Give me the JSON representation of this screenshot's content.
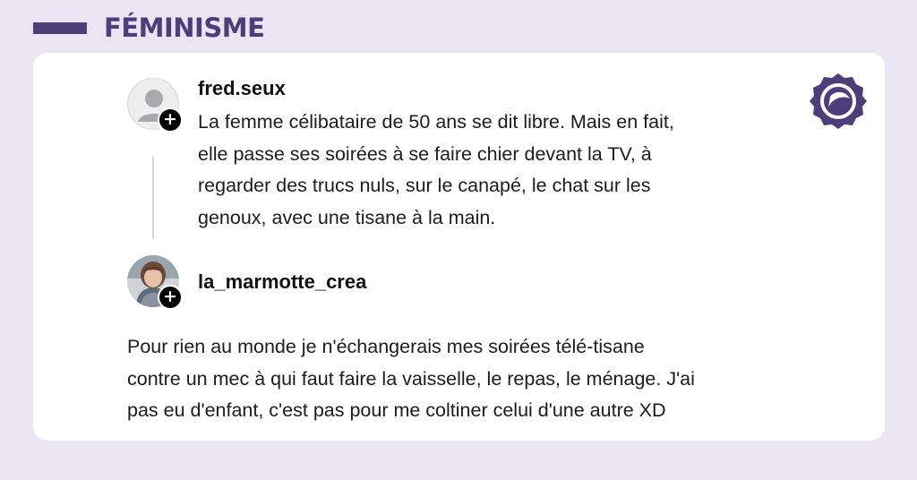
{
  "header": {
    "title": "FÉMINISME"
  },
  "posts": [
    {
      "username": "fred.seux",
      "avatar": "default-user-silhouette",
      "text": "La femme célibataire de 50 ans se dit libre. Mais en fait,\nelle passe ses soirées à se faire chier devant la TV, à\nregarder des trucs nuls, sur le canapé, le chat sur les\ngenoux, avec une tisane à la main."
    },
    {
      "username": "la_marmotte_crea",
      "avatar": "profile-photo",
      "text": "Pour rien au monde je n'échangerais mes soirées télé-tisane\ncontre un mec à qui faut faire la vaisselle, le repas, le ménage. J'ai\npas eu d'enfant, c'est pas pour me coltiner celui d'une autre XD"
    }
  ],
  "badge_symbol": "+",
  "colors": {
    "accent": "#4b3e79",
    "background": "#e9e5f3",
    "card": "#ffffff",
    "text": "#1c1c1c"
  },
  "icons": {
    "logo": "brand-logo-icon",
    "follow": "plus-icon"
  }
}
